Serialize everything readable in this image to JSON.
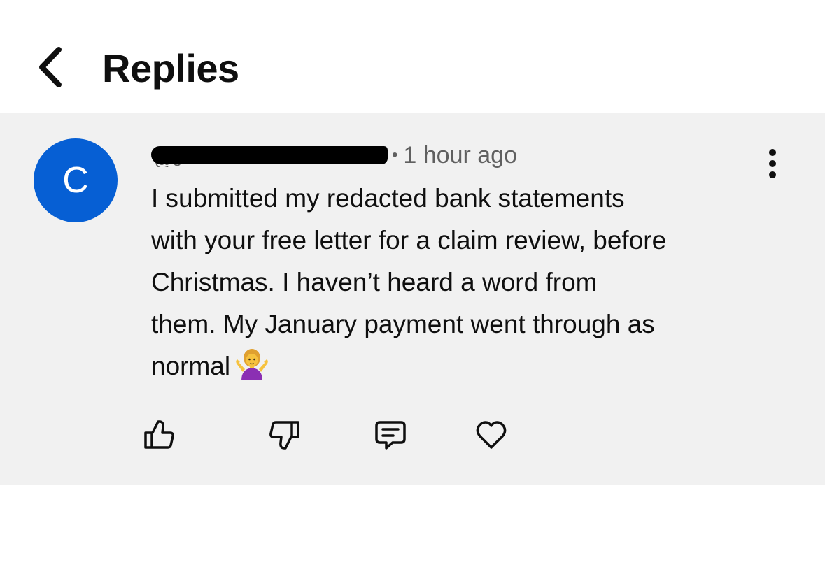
{
  "header": {
    "back_icon": "chevron-left-icon",
    "title": "Replies"
  },
  "comment": {
    "avatar": {
      "letter": "C",
      "color": "#065fd4"
    },
    "author_handle": "@c",
    "author_redacted": true,
    "separator": "•",
    "timestamp": "1 hour ago",
    "more_icon": "more-vertical-icon",
    "text_lines": [
      "I submitted my redacted bank statements",
      "with your free letter for a claim review, before",
      "Christmas.  I haven’t heard a word from",
      "them.  My January payment went through as",
      "normal"
    ],
    "emoji": "person-shrugging-emoji",
    "actions": {
      "like_icon": "thumbs-up-icon",
      "dislike_icon": "thumbs-down-icon",
      "reply_icon": "comment-icon",
      "heart_icon": "heart-icon"
    }
  },
  "colors": {
    "comment_background": "#f1f1f1",
    "text_primary": "#0f0f0f",
    "text_secondary": "#606060",
    "avatar_blue": "#065fd4"
  }
}
